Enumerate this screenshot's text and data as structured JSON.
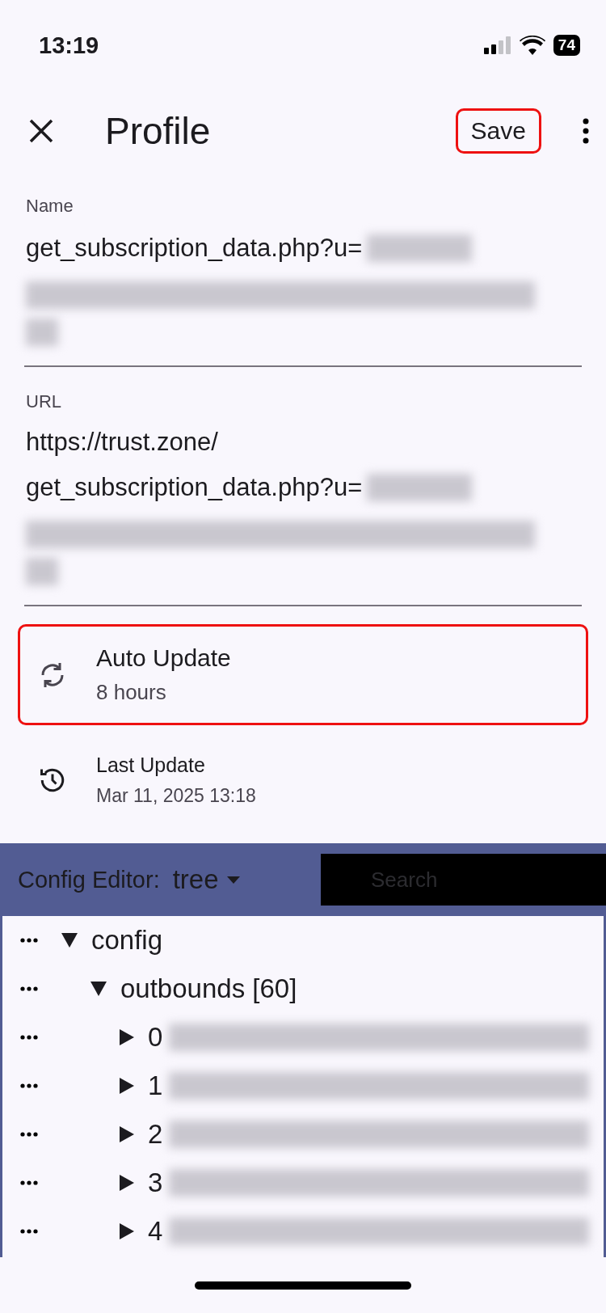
{
  "status_bar": {
    "time": "13:19",
    "battery": "74"
  },
  "app_bar": {
    "title": "Profile",
    "save": {
      "label": "Save",
      "highlighted": true
    }
  },
  "fields": [
    {
      "label": "Name",
      "lines": [
        "get_subscription_data.php?u="
      ]
    },
    {
      "label": "URL",
      "lines": [
        "https://trust.zone/",
        "get_subscription_data.php?u="
      ]
    }
  ],
  "settings": [
    {
      "title": "Auto Update",
      "subtitle": "8 hours",
      "kind": "sync",
      "highlighted": true
    },
    {
      "title": "Last Update",
      "subtitle": "Mar 11, 2025 13:18",
      "kind": "history",
      "highlighted": false
    }
  ],
  "config_editor": {
    "label": "Config Editor:",
    "mode": "tree",
    "search": {
      "placeholder": "Search"
    },
    "tree": [
      {
        "label": "config",
        "expanded": true,
        "children": [
          {
            "label": "outbounds [60]",
            "expanded": true,
            "children": [
              {
                "label": "0",
                "expanded": false
              },
              {
                "label": "1",
                "expanded": false
              },
              {
                "label": "2",
                "expanded": false
              },
              {
                "label": "3",
                "expanded": false
              },
              {
                "label": "4",
                "expanded": false
              }
            ]
          }
        ]
      }
    ]
  }
}
